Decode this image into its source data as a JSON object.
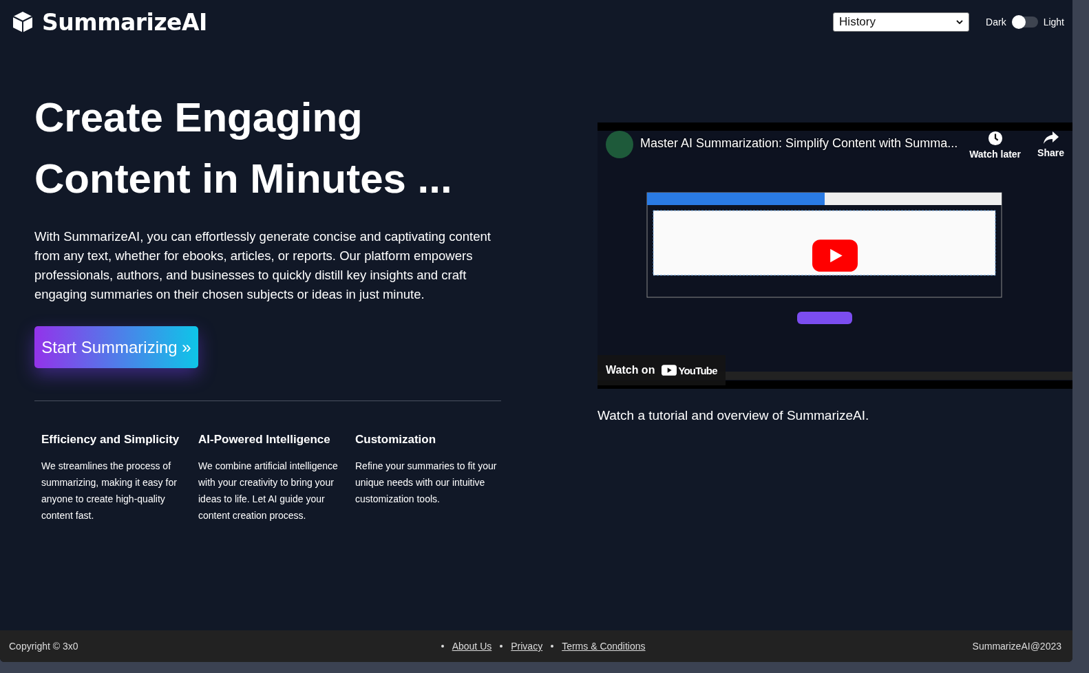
{
  "header": {
    "logo": "SummarizeAI",
    "history_select": {
      "value": "History"
    },
    "theme_toggle": {
      "left_label": "Dark",
      "right_label": "Light",
      "light": false
    }
  },
  "hero": {
    "title_lines": [
      "Create Engaging",
      "Content in Minutes ..."
    ],
    "description": "With SummarizeAI, you can effortlessly generate concise and captivating content from any text, whether for ebooks, articles, or reports. Our platform empowers professionals, authors, and businesses to quickly distill key insights and craft engaging summaries on their chosen subjects or ideas in just minute.",
    "cta": "Start Summarizing »"
  },
  "features": [
    {
      "title": "Efficiency and Simplicity",
      "text": "We streamlines the process of summarizing, making it easy for anyone to create high-quality content fast."
    },
    {
      "title": "AI-Powered Intelligence",
      "text": "We combine artificial intelligence with your creativity to bring your ideas to life. Let AI guide your content creation process."
    },
    {
      "title": "Customization",
      "text": "Refine your summaries to fit your unique needs with our intuitive customization tools."
    }
  ],
  "video": {
    "kind": "picture",
    "title": "Master AI Summarization: Simplify Content with Summa...",
    "watch_later": "Watch later",
    "share": "Share",
    "watch_on": "Watch on",
    "platform": "YouTube",
    "caption": "Watch a tutorial and overview of SummarizeAI."
  },
  "footer": {
    "copyright": "Copyright © 3x0",
    "links": [
      "About Us",
      "Privacy",
      "Terms & Conditions"
    ],
    "brand": "SummarizeAI@2023"
  }
}
